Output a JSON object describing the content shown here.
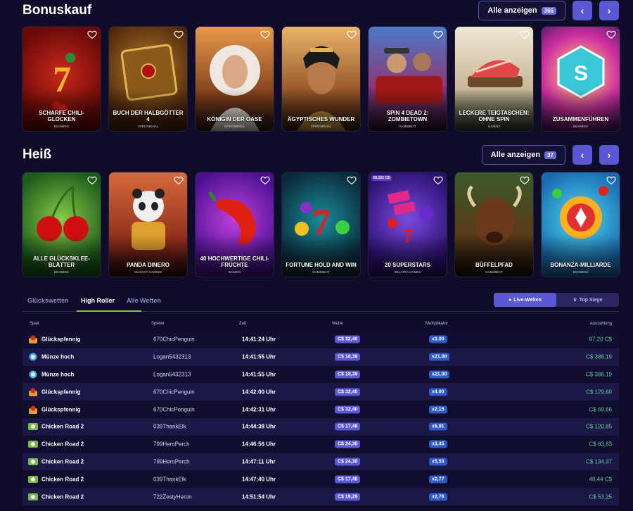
{
  "bonuskauf": {
    "title": "Bonuskauf",
    "see_all": "Alle anzeigen",
    "count": "365",
    "prev": "‹",
    "next": "›",
    "tiles": [
      {
        "name": "Scharfe Chili-Glocken",
        "provider": "Bgaming"
      },
      {
        "name": "Buch der Halbgötter 4",
        "provider": "Spinomenal"
      },
      {
        "name": "Königin der Oase",
        "provider": "Spinomenal"
      },
      {
        "name": "Ägyptisches Wunder",
        "provider": "Spinomenal"
      },
      {
        "name": "Spin 4 Dead 2: Zombietown",
        "provider": "Gamebeat"
      },
      {
        "name": "Leckere Teigtaschen: Ohne Spin",
        "provider": "Gamzix"
      },
      {
        "name": "Zusammenführen",
        "provider": "Bgaming"
      }
    ]
  },
  "heiss": {
    "title": "Heiß",
    "see_all": "Alle anzeigen",
    "count": "37",
    "prev": "‹",
    "next": "›",
    "tiles": [
      {
        "name": "Alle Glücksklee­blätter",
        "provider": "Bgaming"
      },
      {
        "name": "Panda Dinero",
        "provider": "Mascot Gaming"
      },
      {
        "name": "40 Hochwertige Chili-Früchte",
        "provider": "Gamzix"
      },
      {
        "name": "Fortune Hold and Win",
        "provider": "Gamebeat"
      },
      {
        "name": "20 Superstars",
        "provider": "Belatra Games",
        "jackpot": "81.021 C$"
      },
      {
        "name": "Büffelpfad",
        "provider": "Gamebeat"
      },
      {
        "name": "Bonanza-Milliarde",
        "provider": "Bgaming"
      }
    ]
  },
  "bets": {
    "tabs": [
      "Glückswetten",
      "High Roller",
      "Alle Wetten"
    ],
    "active_tab": "High Roller",
    "toggle": [
      "Live-Wetten",
      "Top Siege"
    ],
    "columns": [
      "Spiel",
      "Spieler",
      "Zeit",
      "Wette",
      "Multiplikator",
      "Auszahlung"
    ],
    "rows": [
      {
        "game": "Glückspfennig",
        "icon": "coin-game-icon",
        "player": "670ChicPenguin",
        "time": "14:41:24 Uhr",
        "bet": "C$ 32,40",
        "mult": "x3.00",
        "payout": "97,20 C$"
      },
      {
        "game": "Münze hoch",
        "icon": "coin-flip-icon",
        "player": "Logan5432313",
        "time": "14:41:55 Uhr",
        "bet": "C$ 18,39",
        "mult": "x21.00",
        "payout": "C$ 386,19"
      },
      {
        "game": "Münze hoch",
        "icon": "coin-flip-icon",
        "player": "Logan5432313",
        "time": "14:41:55 Uhr",
        "bet": "C$ 18,39",
        "mult": "x21.00",
        "payout": "C$ 386,19"
      },
      {
        "game": "Glückspfennig",
        "icon": "coin-game-icon",
        "player": "670ChicPenguin",
        "time": "14:42:00 Uhr",
        "bet": "C$ 32,40",
        "mult": "x4.00",
        "payout": "C$ 129,60"
      },
      {
        "game": "Glückspfennig",
        "icon": "coin-game-icon",
        "player": "670ChicPenguin",
        "time": "14:42:31 Uhr",
        "bet": "C$ 32,40",
        "mult": "x2,15",
        "payout": "C$ 69,66"
      },
      {
        "game": "Chicken Road 2",
        "icon": "chicken-road-icon",
        "player": "039ThankElk",
        "time": "14:44:38 Uhr",
        "bet": "C$ 17,48",
        "mult": "x6,91",
        "payout": "C$ 120,85"
      },
      {
        "game": "Chicken Road 2",
        "icon": "chicken-road-icon",
        "player": "799HeroPerch",
        "time": "14:46:56 Uhr",
        "bet": "C$ 24,30",
        "mult": "x3,45",
        "payout": "C$ 83,83"
      },
      {
        "game": "Chicken Road 2",
        "icon": "chicken-road-icon",
        "player": "799HeroPerch",
        "time": "14:47:11 Uhr",
        "bet": "C$ 24,30",
        "mult": "x5,53",
        "payout": "C$ 134,37"
      },
      {
        "game": "Chicken Road 2",
        "icon": "chicken-road-icon",
        "player": "039ThankElk",
        "time": "14:47:40 Uhr",
        "bet": "C$ 17,48",
        "mult": "x2,77",
        "payout": "48,44 C$"
      },
      {
        "game": "Chicken Road 2",
        "icon": "chicken-road-icon",
        "player": "722ZestyHeron",
        "time": "14:51:54 Uhr",
        "bet": "C$ 19,29",
        "mult": "x2,76",
        "payout": "C$ 53,25"
      }
    ]
  }
}
